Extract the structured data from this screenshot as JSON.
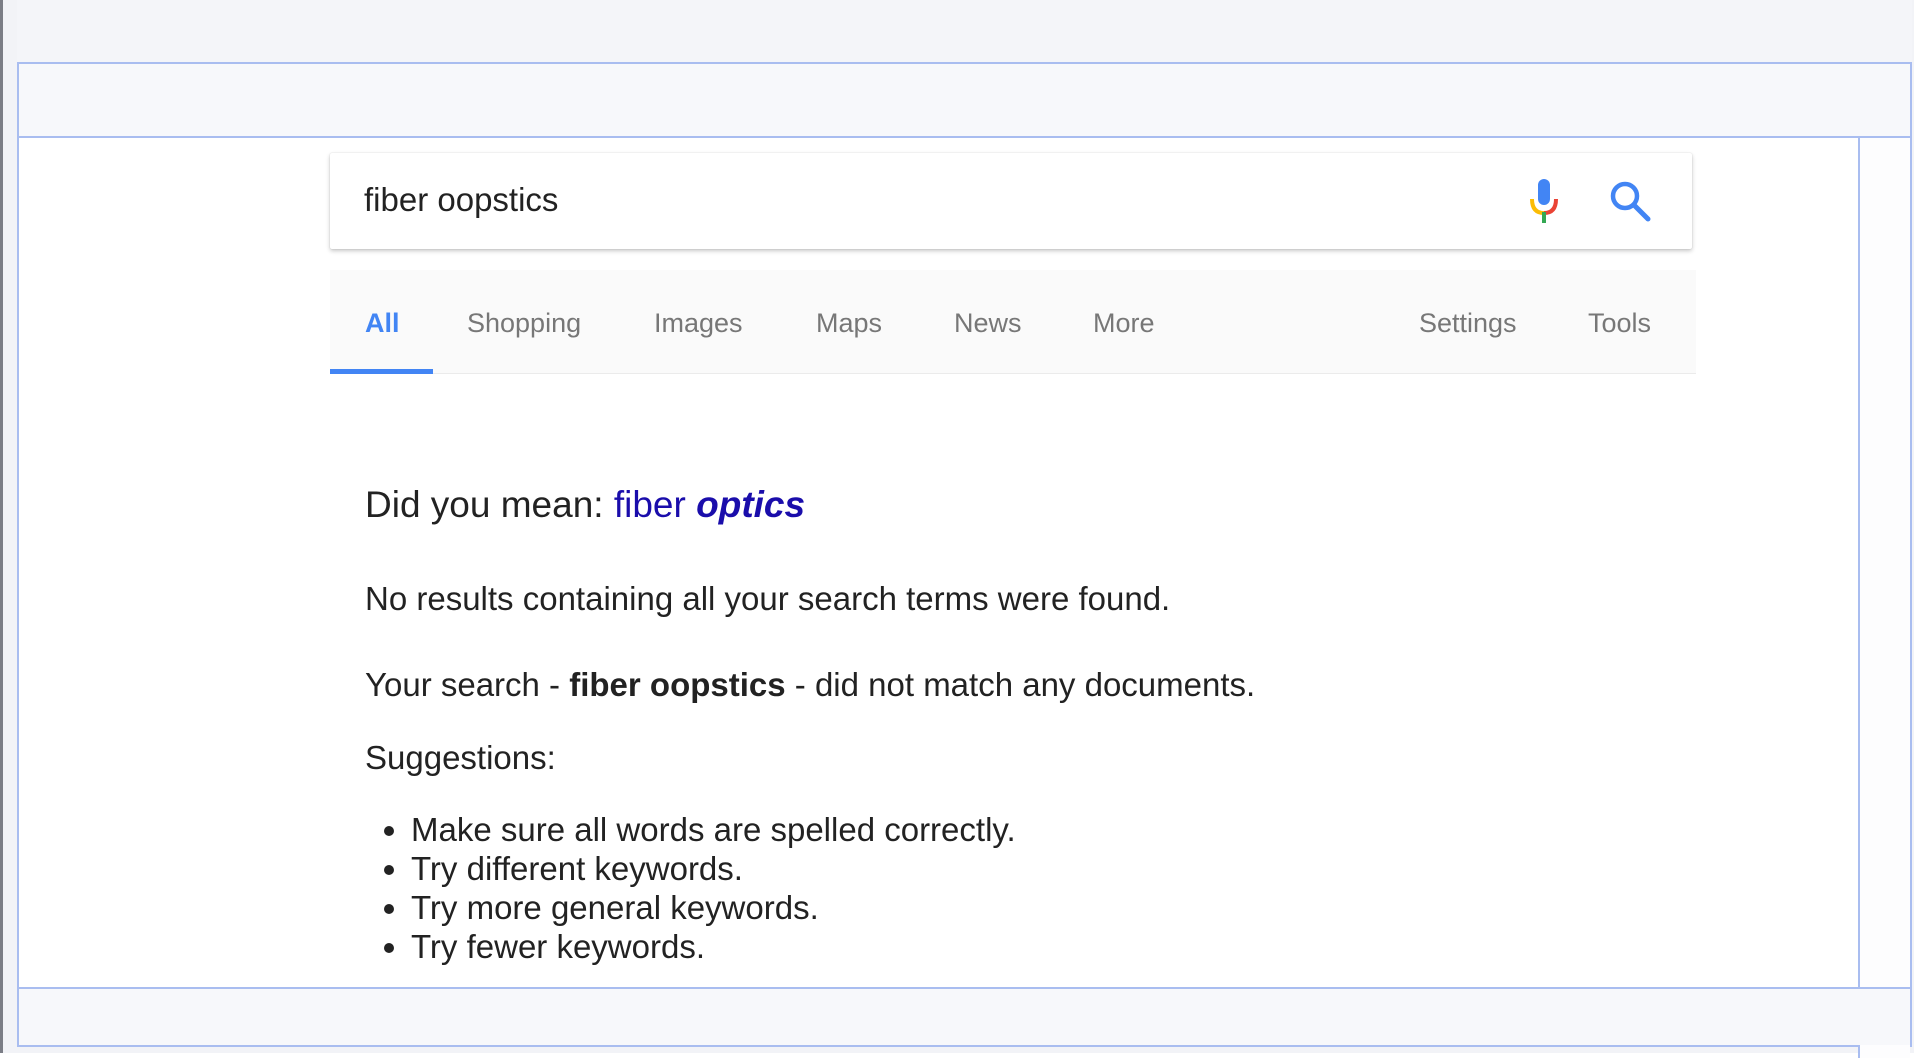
{
  "search": {
    "query": "fiber oopstics",
    "mic_icon": "microphone-icon",
    "search_icon": "magnifier-icon"
  },
  "tabs": [
    {
      "label": "All",
      "active": true
    },
    {
      "label": "Shopping"
    },
    {
      "label": "Images"
    },
    {
      "label": "Maps"
    },
    {
      "label": "News"
    },
    {
      "label": "More"
    }
  ],
  "tools": {
    "settings_label": "Settings",
    "tools_label": "Tools"
  },
  "results": {
    "did_you_mean_prefix": "Did you mean:",
    "suggestion_plain": "fiber",
    "suggestion_corrected": "optics",
    "no_results": "No results containing all your search terms were found.",
    "your_search_prefix": "Your search -",
    "your_search_query": "fiber oopstics",
    "your_search_suffix": "- did not match any documents.",
    "suggestions_heading": "Suggestions:",
    "suggestions": [
      "Make sure all words are spelled correctly.",
      "Try different keywords.",
      "Try more general keywords.",
      "Try fewer keywords."
    ]
  },
  "colors": {
    "accent_blue": "#4285f4",
    "link": "#1a0dab",
    "tab_text": "#777777"
  }
}
